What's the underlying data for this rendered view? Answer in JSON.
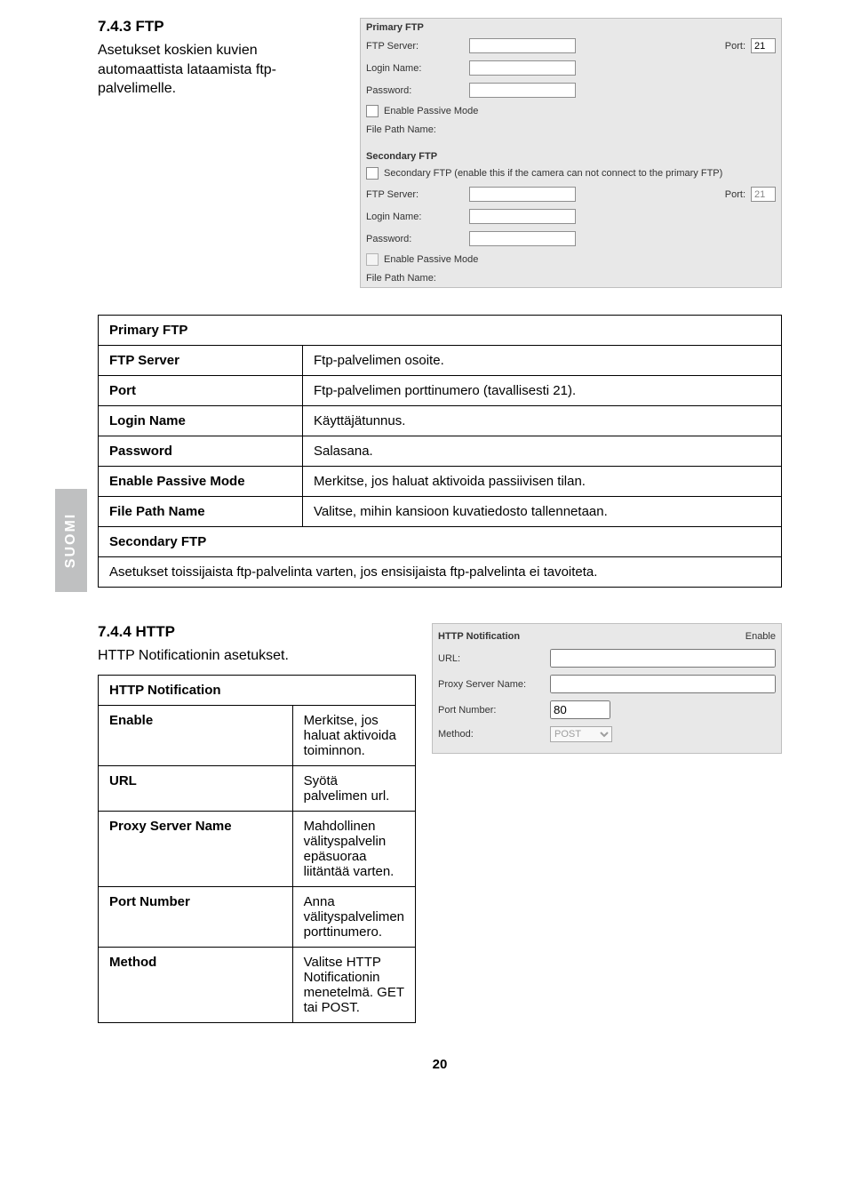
{
  "page_number": "20",
  "side_tab": "SUOMI",
  "section_ftp": {
    "heading": "7.4.3 FTP",
    "intro": "Asetukset koskien kuvien automaattista lataamista ftp-palvelimelle."
  },
  "screenshot_ftp": {
    "primary_title": "Primary FTP",
    "secondary_title": "Secondary FTP",
    "labels": {
      "ftp_server": "FTP Server:",
      "port": "Port:",
      "login_name": "Login Name:",
      "password": "Password:",
      "enable_passive": "Enable Passive Mode",
      "file_path": "File Path Name:"
    },
    "secondary_note": "Secondary FTP (enable this if the camera can not connect to the primary FTP)",
    "port_value": "21",
    "port_value2": "21"
  },
  "table_ftp": {
    "group_header": "Primary FTP",
    "rows": [
      {
        "k": "FTP Server",
        "v": "Ftp-palvelimen osoite."
      },
      {
        "k": "Port",
        "v": "Ftp-palvelimen porttinumero (tavallisesti 21)."
      },
      {
        "k": "Login Name",
        "v": "Käyttäjätunnus."
      },
      {
        "k": "Password",
        "v": "Salasana."
      },
      {
        "k": "Enable Passive Mode",
        "v": "Merkitse, jos haluat aktivoida passiivisen tilan."
      },
      {
        "k": "File Path Name",
        "v": "Valitse, mihin kansioon kuvatiedosto tallennetaan."
      }
    ],
    "secondary_header": "Secondary FTP",
    "secondary_text": "Asetukset toissijaista ftp-palvelinta varten, jos ensisijaista ftp-palvelinta ei tavoiteta."
  },
  "section_http": {
    "heading": "7.4.4 HTTP",
    "intro": "HTTP Notificationin asetukset."
  },
  "screenshot_http": {
    "title": "HTTP Notification",
    "enable": "Enable",
    "url": "URL:",
    "proxy": "Proxy Server Name:",
    "port": "Port Number:",
    "port_value": "80",
    "method": "Method:",
    "method_value": "POST"
  },
  "table_http": {
    "group_header": "HTTP Notification",
    "rows": [
      {
        "k": "Enable",
        "v": "Merkitse, jos haluat aktivoida toiminnon."
      },
      {
        "k": "URL",
        "v": "Syötä palvelimen url."
      },
      {
        "k": "Proxy Server Name",
        "v": "Mahdollinen välityspalvelin epäsuoraa liitäntää varten."
      },
      {
        "k": "Port Number",
        "v": "Anna välityspalvelimen porttinumero."
      },
      {
        "k": "Method",
        "v": "Valitse HTTP Notificationin menetelmä. GET tai POST."
      }
    ]
  }
}
